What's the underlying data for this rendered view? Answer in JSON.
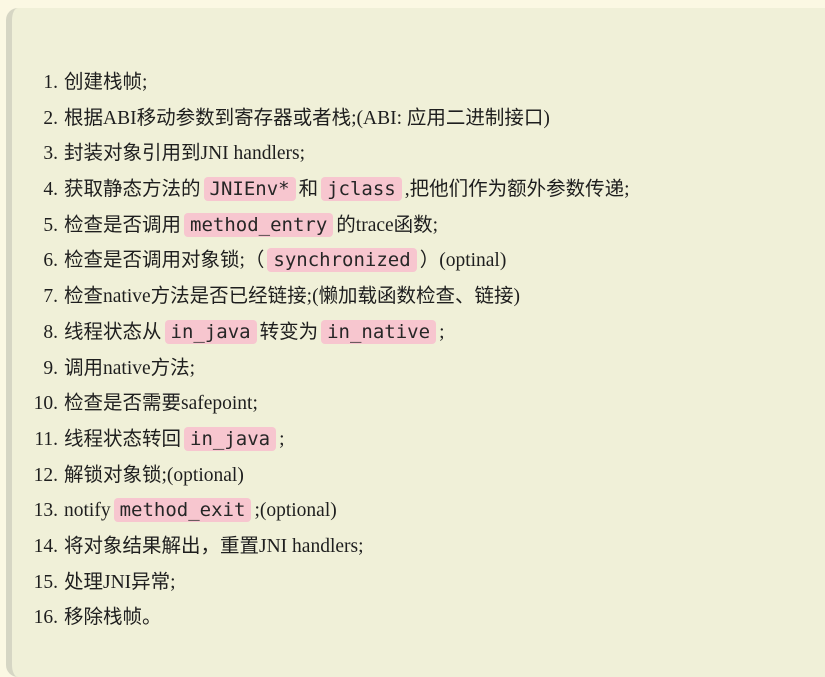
{
  "steps": [
    {
      "num": "1.",
      "parts": [
        {
          "t": "text",
          "v": "创建栈帧;"
        }
      ]
    },
    {
      "num": "2.",
      "parts": [
        {
          "t": "text",
          "v": "根据ABI移动参数到寄存器或者栈;(ABI: 应用二进制接口)"
        }
      ]
    },
    {
      "num": "3.",
      "parts": [
        {
          "t": "text",
          "v": "封装对象引用到JNI handlers;"
        }
      ]
    },
    {
      "num": "4.",
      "parts": [
        {
          "t": "text",
          "v": "获取静态方法的"
        },
        {
          "t": "code",
          "v": "JNIEnv*"
        },
        {
          "t": "text",
          "v": "和"
        },
        {
          "t": "code",
          "v": "jclass"
        },
        {
          "t": "text",
          "v": ",把他们作为额外参数传递;"
        }
      ]
    },
    {
      "num": "5.",
      "parts": [
        {
          "t": "text",
          "v": "检查是否调用"
        },
        {
          "t": "code",
          "v": "method_entry"
        },
        {
          "t": "text",
          "v": "的trace函数;"
        }
      ]
    },
    {
      "num": "6.",
      "parts": [
        {
          "t": "text",
          "v": "检查是否调用对象锁;（"
        },
        {
          "t": "code",
          "v": "synchronized"
        },
        {
          "t": "text",
          "v": "）(optinal)"
        }
      ]
    },
    {
      "num": "7.",
      "parts": [
        {
          "t": "text",
          "v": "检查native方法是否已经链接;(懒加载函数检查、链接)"
        }
      ]
    },
    {
      "num": "8.",
      "parts": [
        {
          "t": "text",
          "v": "线程状态从"
        },
        {
          "t": "code",
          "v": "in_java"
        },
        {
          "t": "text",
          "v": "转变为"
        },
        {
          "t": "code",
          "v": "in_native"
        },
        {
          "t": "text",
          "v": ";"
        }
      ]
    },
    {
      "num": "9.",
      "parts": [
        {
          "t": "text",
          "v": "调用native方法;"
        }
      ]
    },
    {
      "num": "10.",
      "parts": [
        {
          "t": "text",
          "v": "检查是否需要safepoint;"
        }
      ]
    },
    {
      "num": "11.",
      "parts": [
        {
          "t": "text",
          "v": "线程状态转回"
        },
        {
          "t": "code",
          "v": "in_java"
        },
        {
          "t": "text",
          "v": ";"
        }
      ]
    },
    {
      "num": "12.",
      "parts": [
        {
          "t": "text",
          "v": "解锁对象锁;(optional)"
        }
      ]
    },
    {
      "num": "13.",
      "parts": [
        {
          "t": "text",
          "v": "notify"
        },
        {
          "t": "code",
          "v": "method_exit"
        },
        {
          "t": "text",
          "v": ";(optional)"
        }
      ]
    },
    {
      "num": "14.",
      "parts": [
        {
          "t": "text",
          "v": "将对象结果解出，重置JNI handlers;"
        }
      ]
    },
    {
      "num": "15.",
      "parts": [
        {
          "t": "text",
          "v": "处理JNI异常;"
        }
      ]
    },
    {
      "num": "16.",
      "parts": [
        {
          "t": "text",
          "v": "移除栈帧。"
        }
      ]
    }
  ],
  "colors": {
    "page_background": "#fbf8e3",
    "quote_background": "#f0f0d8",
    "quote_border": "#d6d6c4",
    "code_background": "#f7c6cf",
    "text": "#1e1e1e"
  }
}
